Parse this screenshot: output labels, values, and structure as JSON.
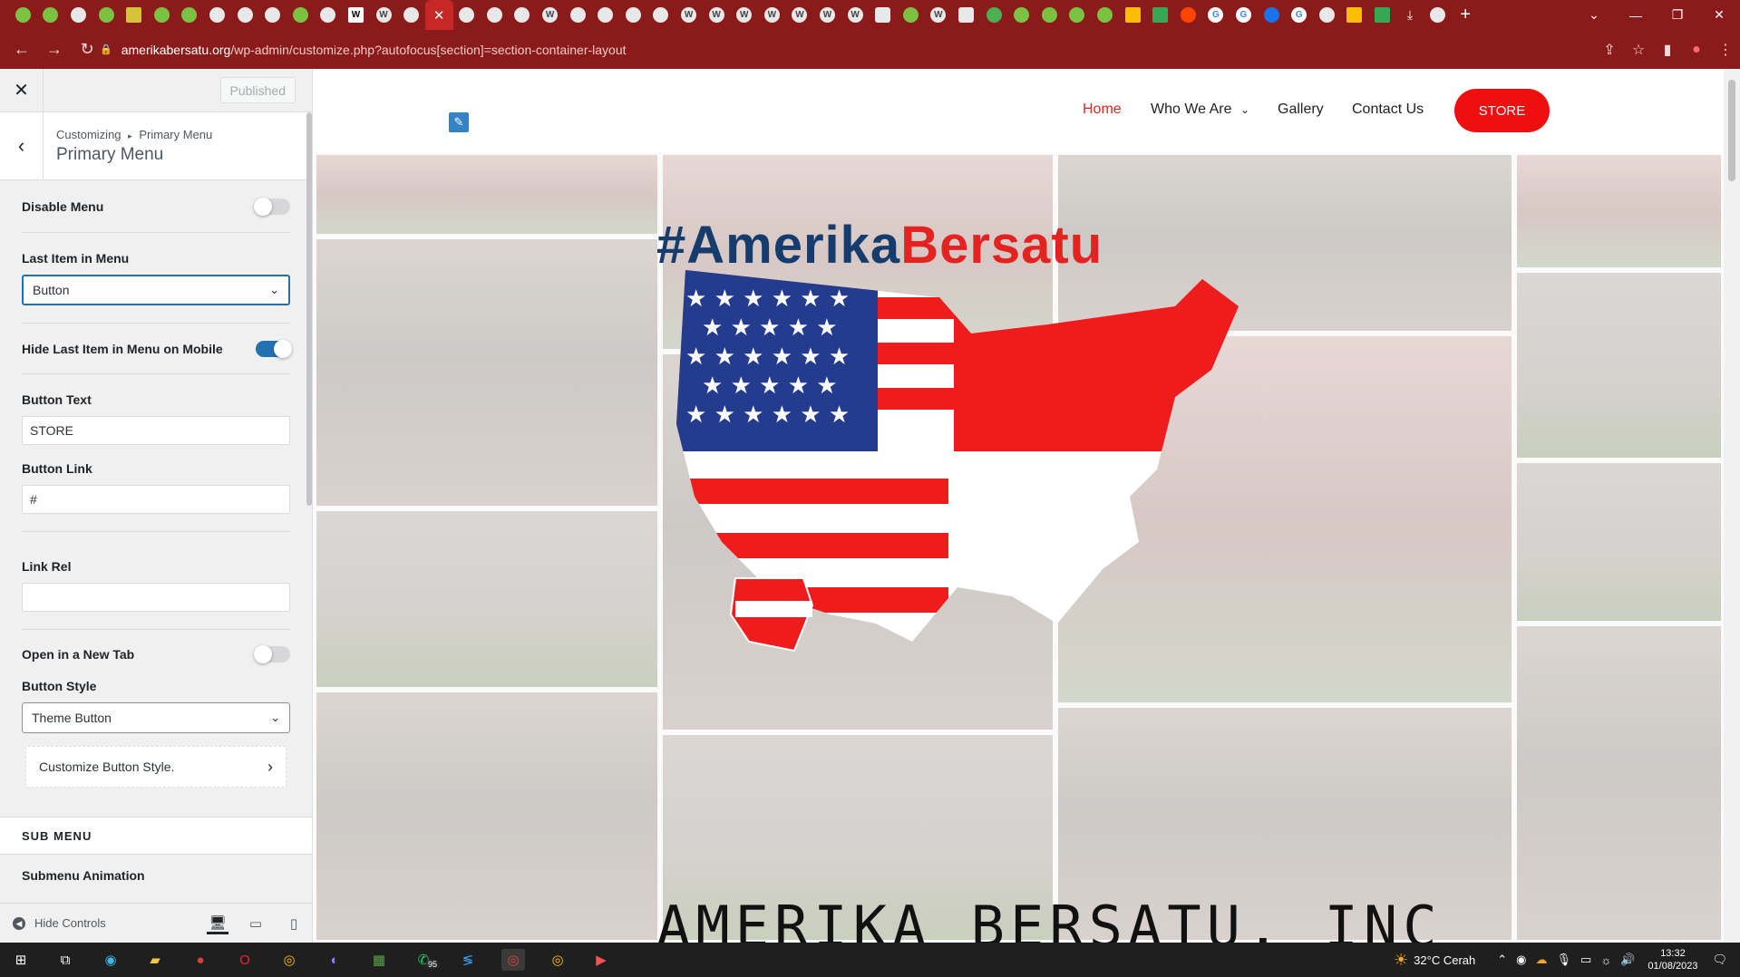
{
  "browser": {
    "url_host": "amerikabersatu.org",
    "url_path": "/wp-admin/customize.php?autofocus[section]=section-container-layout",
    "active_tab_glyph": "✕"
  },
  "customizer": {
    "published_label": "Published",
    "breadcrumb_root": "Customizing",
    "breadcrumb_separator": "▸",
    "breadcrumb_current": "Primary Menu",
    "section_title": "Primary Menu",
    "disable_menu_label": "Disable Menu",
    "disable_menu_on": false,
    "last_item_label": "Last Item in Menu",
    "last_item_value": "Button",
    "hide_last_item_label": "Hide Last Item in Menu on Mobile",
    "hide_last_item_on": true,
    "button_text_label": "Button Text",
    "button_text_value": "STORE",
    "button_link_label": "Button Link",
    "button_link_value": "#",
    "link_rel_label": "Link Rel",
    "link_rel_value": "",
    "new_tab_label": "Open in a New Tab",
    "new_tab_on": false,
    "button_style_label": "Button Style",
    "button_style_value": "Theme Button",
    "customize_button_style_label": "Customize Button Style.",
    "sub_menu_heading": "SUB MENU",
    "submenu_animation_label": "Submenu Animation",
    "hide_controls_label": "Hide Controls"
  },
  "site": {
    "nav": [
      {
        "label": "Home",
        "active": true
      },
      {
        "label": "Who We Are",
        "has_dropdown": true
      },
      {
        "label": "Gallery"
      },
      {
        "label": "Contact Us"
      }
    ],
    "store_button": "STORE",
    "hero_hashtag_prefix": "#",
    "hero_hashtag_blue": "Amerika",
    "hero_hashtag_red": "Bersatu",
    "hero_org_name": "AMERIKA BERSATU, INC"
  },
  "taskbar": {
    "weather": "32°C  Cerah",
    "time": "13:32",
    "date": "01/08/2023",
    "whatsapp_badge": "95"
  },
  "colors": {
    "browser_chrome": "#8b1b1b",
    "wp_blue": "#2271b1",
    "site_red": "#f00f0f",
    "hashtag_blue": "#163c6e",
    "hashtag_red": "#e3231f"
  }
}
